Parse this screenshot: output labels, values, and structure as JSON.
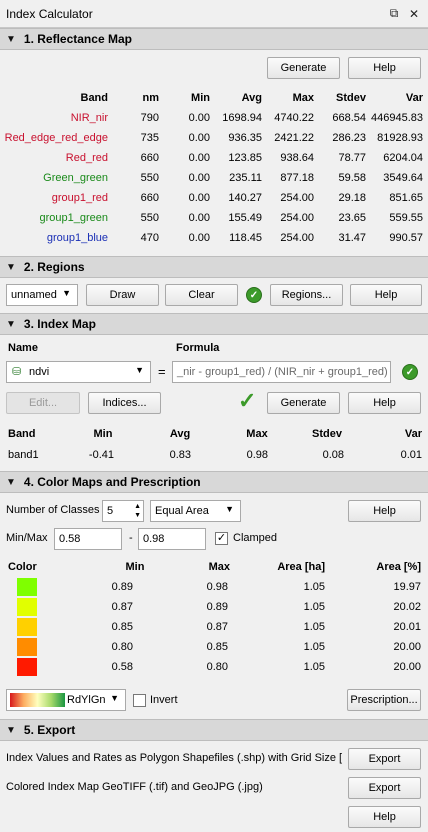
{
  "window": {
    "title": "Index Calculator"
  },
  "s1": {
    "title": "1. Reflectance Map",
    "generate": "Generate",
    "help": "Help",
    "headers": [
      "Band",
      "nm",
      "Min",
      "Avg",
      "Max",
      "Stdev",
      "Var"
    ],
    "rows": [
      {
        "band": "NIR_nir",
        "color": "#c8102e",
        "nm": "790",
        "min": "0.00",
        "avg": "1698.94",
        "max": "4740.22",
        "stdev": "668.54",
        "var": "446945.83"
      },
      {
        "band": "Red_edge_red_edge",
        "color": "#c8102e",
        "nm": "735",
        "min": "0.00",
        "avg": "936.35",
        "max": "2421.22",
        "stdev": "286.23",
        "var": "81928.93"
      },
      {
        "band": "Red_red",
        "color": "#c8102e",
        "nm": "660",
        "min": "0.00",
        "avg": "123.85",
        "max": "938.64",
        "stdev": "78.77",
        "var": "6204.04"
      },
      {
        "band": "Green_green",
        "color": "#1a8a1a",
        "nm": "550",
        "min": "0.00",
        "avg": "235.11",
        "max": "877.18",
        "stdev": "59.58",
        "var": "3549.64"
      },
      {
        "band": "group1_red",
        "color": "#c8102e",
        "nm": "660",
        "min": "0.00",
        "avg": "140.27",
        "max": "254.00",
        "stdev": "29.18",
        "var": "851.65"
      },
      {
        "band": "group1_green",
        "color": "#1a8a1a",
        "nm": "550",
        "min": "0.00",
        "avg": "155.49",
        "max": "254.00",
        "stdev": "23.65",
        "var": "559.55"
      },
      {
        "band": "group1_blue",
        "color": "#1a2fb5",
        "nm": "470",
        "min": "0.00",
        "avg": "118.45",
        "max": "254.00",
        "stdev": "31.47",
        "var": "990.57"
      }
    ]
  },
  "s2": {
    "title": "2. Regions",
    "region_select": "unnamed",
    "draw": "Draw",
    "clear": "Clear",
    "regions": "Regions...",
    "help": "Help"
  },
  "s3": {
    "title": "3. Index Map",
    "name_label": "Name",
    "formula_label": "Formula",
    "index_select": "ndvi",
    "equals": "=",
    "formula": "_nir - group1_red) / (NIR_nir + group1_red)",
    "edit": "Edit...",
    "indices": "Indices...",
    "generate": "Generate",
    "help": "Help",
    "headers": [
      "Band",
      "Min",
      "Avg",
      "Max",
      "Stdev",
      "Var"
    ],
    "row": {
      "band": "band1",
      "min": "-0.41",
      "avg": "0.83",
      "max": "0.98",
      "stdev": "0.08",
      "var": "0.01"
    }
  },
  "s4": {
    "title": "4. Color Maps and Prescription",
    "num_classes_label": "Number of Classes",
    "num_classes": "5",
    "method": "Equal Area",
    "help": "Help",
    "minmax_label": "Min/Max",
    "min_value": "0.58",
    "dash": "-",
    "max_value": "0.98",
    "clamped_label": "Clamped",
    "clamped": true,
    "headers": [
      "Color",
      "Min",
      "Max",
      "Area [ha]",
      "Area [%]"
    ],
    "rows": [
      {
        "color": "#7fff00",
        "min": "0.89",
        "max": "0.98",
        "area_ha": "1.05",
        "area_pct": "19.97"
      },
      {
        "color": "#e1ff00",
        "min": "0.87",
        "max": "0.89",
        "area_ha": "1.05",
        "area_pct": "20.02"
      },
      {
        "color": "#ffd000",
        "min": "0.85",
        "max": "0.87",
        "area_ha": "1.05",
        "area_pct": "20.01"
      },
      {
        "color": "#ff8c00",
        "min": "0.80",
        "max": "0.85",
        "area_ha": "1.05",
        "area_pct": "20.00"
      },
      {
        "color": "#ff1a00",
        "min": "0.58",
        "max": "0.80",
        "area_ha": "1.05",
        "area_pct": "20.00"
      }
    ],
    "colormap": "RdYlGn",
    "invert_label": "Invert",
    "invert": false,
    "prescription": "Prescription..."
  },
  "s5": {
    "title": "5. Export",
    "shp_label": "Index Values and Rates as Polygon Shapefiles (.shp) with Grid Size [cr",
    "export1": "Export",
    "tif_label": "Colored Index Map GeoTIFF (.tif) and GeoJPG (.jpg)",
    "export2": "Export",
    "help": "Help"
  }
}
